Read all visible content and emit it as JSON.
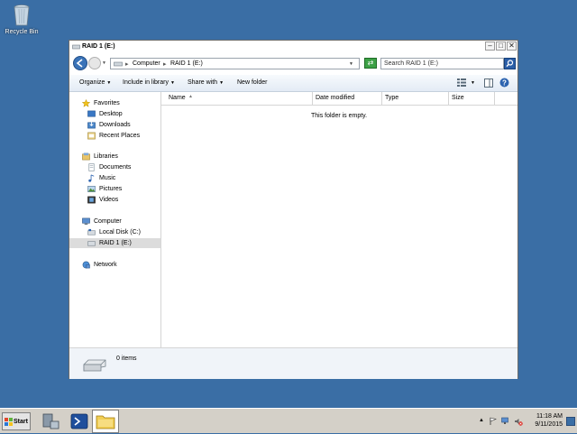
{
  "desktop": {
    "recycle_bin_label": "Recycle Bin"
  },
  "window": {
    "title": "RAID 1 (E:)",
    "controls": {
      "minimize": "–",
      "maximize": "□",
      "close": "✕"
    },
    "address": {
      "segments": [
        "Computer",
        "RAID 1 (E:)"
      ],
      "separator": "▸"
    },
    "search": {
      "placeholder": "Search RAID 1 (E:)"
    },
    "toolbar": {
      "organize": "Organize",
      "include_in_library": "Include in library",
      "share_with": "Share with",
      "new_folder": "New folder"
    },
    "nav": {
      "favorites": {
        "label": "Favorites",
        "items": [
          "Desktop",
          "Downloads",
          "Recent Places"
        ]
      },
      "libraries": {
        "label": "Libraries",
        "items": [
          "Documents",
          "Music",
          "Pictures",
          "Videos"
        ]
      },
      "computer": {
        "label": "Computer",
        "items": [
          "Local Disk (C:)",
          "RAID 1 (E:)"
        ]
      },
      "network": {
        "label": "Network"
      }
    },
    "columns": {
      "name": "Name",
      "date_modified": "Date modified",
      "type": "Type",
      "size": "Size"
    },
    "empty_message": "This folder is empty.",
    "details": {
      "item_count": "0 items"
    }
  },
  "taskbar": {
    "start_label": "Start",
    "clock": {
      "time": "11:18 AM",
      "date": "9/11/2015"
    }
  },
  "colors": {
    "desktop": "#3a6ea5",
    "window_bg": "#f0f0f0",
    "selection": "#dcdcdc",
    "taskbar": "#d4d0c8"
  }
}
